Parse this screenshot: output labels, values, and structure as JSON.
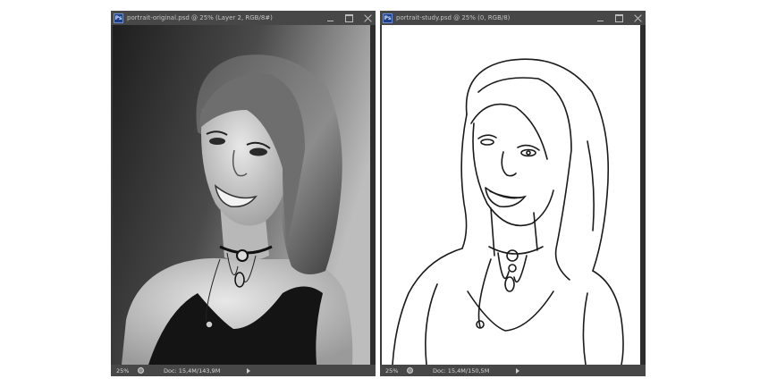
{
  "left_window": {
    "title": "portrait-original.psd @ 25% (Layer 2, RGB/8#)",
    "zoom": "25%",
    "doc_info": "Doc: 15,4M/143,9M"
  },
  "right_window": {
    "title": "portrait-study.psd @ 25% (0, RGB/8)",
    "zoom": "25%",
    "doc_info": "Doc: 15,4M/150,5M"
  },
  "app_icon_label": "Ps",
  "colors": {
    "window_frame": "#3a3a3a",
    "titlebar": "#474747",
    "title_text": "#c4c4c4",
    "canvas_right": "#ffffff"
  },
  "icons": {
    "app": "photoshop-icon",
    "minimize": "minimize-icon",
    "maximize": "maximize-icon",
    "close": "close-icon",
    "status_menu": "status-menu-icon",
    "arrow": "status-arrow-icon"
  }
}
